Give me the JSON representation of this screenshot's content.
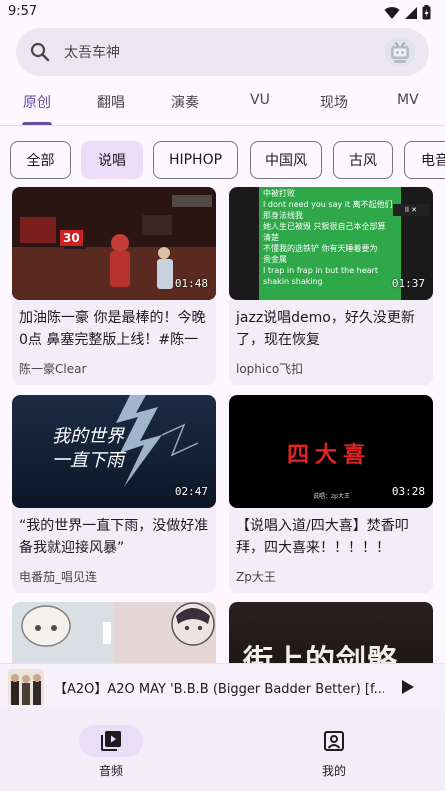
{
  "status_bar": {
    "time": "9:57"
  },
  "search": {
    "placeholder": "太吾车神"
  },
  "tabs": [
    {
      "label": "原创",
      "active": true
    },
    {
      "label": "翻唱",
      "active": false
    },
    {
      "label": "演奏",
      "active": false
    },
    {
      "label": "VU",
      "active": false
    },
    {
      "label": "现场",
      "active": false
    },
    {
      "label": "MV",
      "active": false
    }
  ],
  "chips": [
    {
      "label": "全部",
      "selected": false
    },
    {
      "label": "说唱",
      "selected": true
    },
    {
      "label": "HIPHOP",
      "selected": false
    },
    {
      "label": "中国风",
      "selected": false
    },
    {
      "label": "古风",
      "selected": false
    },
    {
      "label": "电音",
      "selected": false
    }
  ],
  "cards": [
    {
      "title": "加油陈一豪 你是最棒的！今晚0点 鼻塞完整版上线！#陈一豪",
      "author": "陈一豪Clear",
      "duration": "01:48",
      "thumb_overlay": "30"
    },
    {
      "title": "jazz说唱demo，好久没更新了，现在恢复",
      "author": "lophico飞扣",
      "duration": "01:37",
      "thumb_lines": [
        "中被打败",
        "I dont need you say it 离不起他们",
        "那身法线我",
        "她人生已被毁 只狠很自己本全部算",
        "清楚",
        "不懂我的选铁铲 你有天睡着要为",
        "贵金属",
        "I trap in frap in but the heart",
        "shakin shaking"
      ]
    },
    {
      "title": "“我的世界一直下雨，没做好准备我就迎接风暴”",
      "author": "电番茄_唱见连",
      "duration": "02:47",
      "thumb_text": "我的世界 一直下雨"
    },
    {
      "title": "【说唱入道/四大喜】焚香叩拜，四大喜来！！！！！",
      "author": "Zp大王",
      "duration": "03:28",
      "thumb_text": "四大喜",
      "thumb_sub": "说唱：zp大王"
    },
    {
      "title": "",
      "author": "",
      "duration": ""
    },
    {
      "title": "",
      "author": "",
      "duration": "",
      "thumb_text": "街上的剑骼"
    }
  ],
  "mini_player": {
    "title": "【A2O】A2O MAY 'B.B.B (Bigger Badder Better) [f..."
  },
  "bottom_nav": [
    {
      "label": "音频",
      "icon": "video-library-icon",
      "active": true
    },
    {
      "label": "我的",
      "icon": "account-box-icon",
      "active": false
    }
  ],
  "colors": {
    "accent": "#6750a4",
    "selected_chip": "#e8def8",
    "surface": "#fdf7ff"
  }
}
